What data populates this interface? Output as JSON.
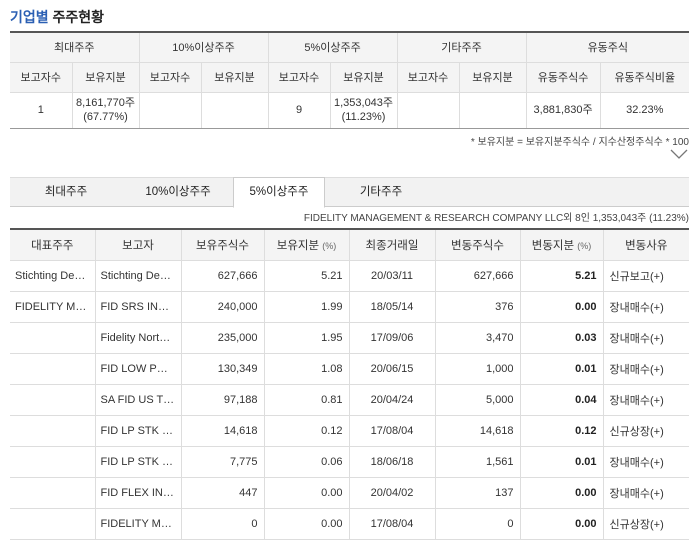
{
  "title": {
    "accent": "기업별",
    "rest": "주주현황"
  },
  "summary": {
    "groups": [
      "최대주주",
      "10%이상주주",
      "5%이상주주",
      "기타주주",
      "유동주식"
    ],
    "subheaders": [
      "보고자수",
      "보유지분",
      "보고자수",
      "보유지분",
      "보고자수",
      "보유지분",
      "보고자수",
      "보유지분",
      "유동주식수",
      "유동주식비율"
    ],
    "row": {
      "largest_count": "1",
      "largest_stake_shares": "8,161,770주",
      "largest_stake_pct": "(67.77%)",
      "over10_count": "",
      "over10_stake": "",
      "over5_count": "9",
      "over5_stake_shares": "1,353,043주",
      "over5_stake_pct": "(11.23%)",
      "other_count": "",
      "other_stake": "",
      "float_shares": "3,881,830주",
      "float_ratio": "32.23%"
    }
  },
  "footnote": "* 보유지분 = 보유지분주식수 / 지수산정주식수 * 100",
  "icons": {
    "expand": "chevron-down-icon"
  },
  "tabs": [
    {
      "label": "최대주주",
      "active": false
    },
    {
      "label": "10%이상주주",
      "active": false
    },
    {
      "label": "5%이상주주",
      "active": true
    },
    {
      "label": "기타주주",
      "active": false
    }
  ],
  "subinfo": "FIDELITY MANAGEMENT & RESEARCH COMPANY LLC외 8인 1,353,043주 (11.23%)",
  "detail": {
    "headers": {
      "rep": "대표주주",
      "reporter": "보고자",
      "shares": "보유주식수",
      "stake": "보유지분",
      "stake_unit": "(%)",
      "last_trade": "최종거래일",
      "change_shares": "변동주식수",
      "change_stake": "변동지분",
      "change_unit": "(%)",
      "reason": "변동사유"
    },
    "rows": [
      {
        "rep": "Stichting Depo…",
        "reporter": "Stichting Depo…",
        "shares": "627,666",
        "stake": "5.21",
        "date": "20/03/11",
        "chg_shares": "627,666",
        "chg_stake": "5.21",
        "reason": "신규보고(+)"
      },
      {
        "rep": "FIDELITY MAN…",
        "reporter": "FID SRS INTRI…",
        "shares": "240,000",
        "stake": "1.99",
        "date": "18/05/14",
        "chg_shares": "376",
        "chg_stake": "0.00",
        "reason": "장내매수(+)"
      },
      {
        "rep": "",
        "reporter": "Fidelity Norths…",
        "shares": "235,000",
        "stake": "1.95",
        "date": "17/09/06",
        "chg_shares": "3,470",
        "chg_stake": "0.03",
        "reason": "장내매수(+)"
      },
      {
        "rep": "",
        "reporter": "FID LOW PRIC…",
        "shares": "130,349",
        "stake": "1.08",
        "date": "20/06/15",
        "chg_shares": "1,000",
        "chg_stake": "0.01",
        "reason": "장내매수(+)"
      },
      {
        "rep": "",
        "reporter": "SA FID US TO…",
        "shares": "97,188",
        "stake": "0.81",
        "date": "20/04/24",
        "chg_shares": "5,000",
        "chg_stake": "0.04",
        "reason": "장내매수(+)"
      },
      {
        "rep": "",
        "reporter": "FID LP STK CP…",
        "shares": "14,618",
        "stake": "0.12",
        "date": "17/08/04",
        "chg_shares": "14,618",
        "chg_stake": "0.12",
        "reason": "신규상장(+)"
      },
      {
        "rep": "",
        "reporter": "FID LP STK K6…",
        "shares": "7,775",
        "stake": "0.06",
        "date": "18/06/18",
        "chg_shares": "1,561",
        "chg_stake": "0.01",
        "reason": "장내매수(+)"
      },
      {
        "rep": "",
        "reporter": "FID FLEX INTR…",
        "shares": "447",
        "stake": "0.00",
        "date": "20/04/02",
        "chg_shares": "137",
        "chg_stake": "0.00",
        "reason": "장내매수(+)"
      },
      {
        "rep": "",
        "reporter": "FIDELITY MA…",
        "shares": "0",
        "stake": "0.00",
        "date": "17/08/04",
        "chg_shares": "0",
        "chg_stake": "0.00",
        "reason": "신규상장(+)"
      }
    ]
  },
  "colors": {
    "accent": "#2b5fb3",
    "header_bg": "#f4f4f4",
    "border": "#dddddd"
  }
}
